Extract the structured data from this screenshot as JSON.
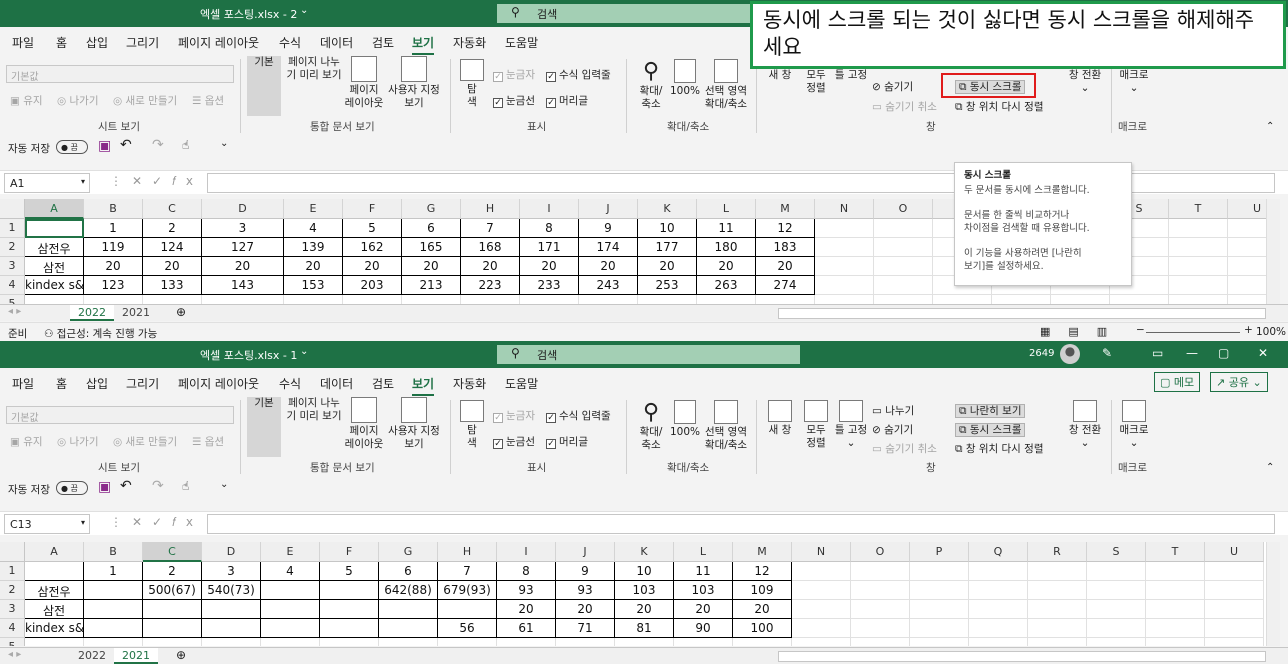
{
  "windows": [
    {
      "title": "엑셀 포스팅.xlsx - 2",
      "search": "검색",
      "menu": [
        "파일",
        "홈",
        "삽입",
        "그리기",
        "페이지 레이아웃",
        "수식",
        "데이터",
        "검토",
        "보기",
        "자동화",
        "도움말"
      ],
      "active_menu": "보기",
      "namebox": "A1",
      "columns": [
        "A",
        "B",
        "C",
        "D",
        "E",
        "F",
        "G",
        "H",
        "I",
        "J",
        "K",
        "L",
        "M",
        "N",
        "O",
        "P",
        "Q",
        "R",
        "S",
        "T",
        "U"
      ],
      "rows": [
        [
          "",
          "1",
          "2",
          "3",
          "4",
          "5",
          "6",
          "7",
          "8",
          "9",
          "10",
          "11",
          "12"
        ],
        [
          "삼전우",
          "119",
          "124",
          "127",
          "139",
          "162",
          "165",
          "168",
          "171",
          "174",
          "177",
          "180",
          "183"
        ],
        [
          "삼전",
          "20",
          "20",
          "20",
          "20",
          "20",
          "20",
          "20",
          "20",
          "20",
          "20",
          "20",
          "20"
        ],
        [
          "kindex s&p",
          "123",
          "133",
          "143",
          "153",
          "203",
          "213",
          "223",
          "233",
          "243",
          "253",
          "263",
          "274"
        ]
      ],
      "sheet_tabs": [
        "2022",
        "2021"
      ],
      "active_tab": "2022"
    },
    {
      "title": "엑셀 포스팅.xlsx - 1",
      "search": "검색",
      "menu": [
        "파일",
        "홈",
        "삽입",
        "그리기",
        "페이지 레이아웃",
        "수식",
        "데이터",
        "검토",
        "보기",
        "자동화",
        "도움말"
      ],
      "active_menu": "보기",
      "namebox": "C13",
      "columns": [
        "A",
        "B",
        "C",
        "D",
        "E",
        "F",
        "G",
        "H",
        "I",
        "J",
        "K",
        "L",
        "M",
        "N",
        "O",
        "P",
        "Q",
        "R",
        "S",
        "T",
        "U"
      ],
      "rows": [
        [
          "",
          "1",
          "2",
          "3",
          "4",
          "5",
          "6",
          "7",
          "8",
          "9",
          "10",
          "11",
          "12"
        ],
        [
          "삼전우",
          "",
          "500(67)",
          "540(73)",
          "",
          "",
          "642(88)",
          "679(93)",
          "93",
          "93",
          "103",
          "103",
          "109"
        ],
        [
          "삼전",
          "",
          "",
          "",
          "",
          "",
          "",
          "",
          "20",
          "20",
          "20",
          "20",
          "20"
        ],
        [
          "kindex s&p",
          "",
          "",
          "",
          "",
          "",
          "",
          "56",
          "61",
          "71",
          "81",
          "90",
          "100"
        ]
      ],
      "sheet_tabs": [
        "2022",
        "2021"
      ],
      "active_tab": "2021",
      "user_id": "2649",
      "memo_label": "메모",
      "share_label": "공유"
    }
  ],
  "ribbon": {
    "sheet_view_combo": "기본값",
    "keep": "유지",
    "exit": "나가기",
    "new": "새로 만들기",
    "options": "옵션",
    "group_sheet_view": "시트 보기",
    "normal": "기본",
    "page_break": "페이지 나누\n기 미리 보기",
    "page_layout": "페이지\n레이아웃",
    "custom_view": "사용자 지정\n보기",
    "group_workbook_views": "통합 문서 보기",
    "navigation": "탐\n색",
    "ruler": "눈금자",
    "formula_bar": "수식 입력줄",
    "gridlines": "눈금선",
    "headings": "머리글",
    "group_show": "표시",
    "zoom": "확대/\n축소",
    "zoom100": "100%",
    "zoom_selection": "선택 영역\n확대/축소",
    "group_zoom": "확대/축소",
    "new_window": "새 창",
    "arrange_all": "모두\n정렬",
    "freeze_panes": "틀 고정",
    "split": "나누기",
    "hide": "숨기기",
    "unhide": "숨기기 취소",
    "view_side_by_side": "나란히 보기",
    "sync_scroll": "동시 스크롤",
    "reset_position": "창 위치 다시 정렬",
    "switch_window": "창 전환",
    "group_window": "창",
    "macros": "매크로",
    "group_macros": "매크로"
  },
  "qat": {
    "autosave": "자동 저장",
    "autosave_state": "끔"
  },
  "status": {
    "ready": "준비",
    "accessibility": "접근성: 계속 진행 가능",
    "zoom": "100%"
  },
  "tooltip": {
    "title": "동시 스크롤",
    "line1": "두 문서를 동시에 스크롤합니다.",
    "line2": "문서를 한 줄씩 비교하거나\n차이점을 검색할 때 유용합니다.",
    "line3": "이 기능을 사용하려면 [나란히\n보기]를 설정하세요."
  },
  "callout": "동시에 스크롤 되는 것이 싫다면 동시 스크롤을 해제해주세요",
  "colors": {
    "excel_green": "#1e7145",
    "callout_border": "#1f9a4b",
    "highlight_red": "#e01b1b"
  }
}
